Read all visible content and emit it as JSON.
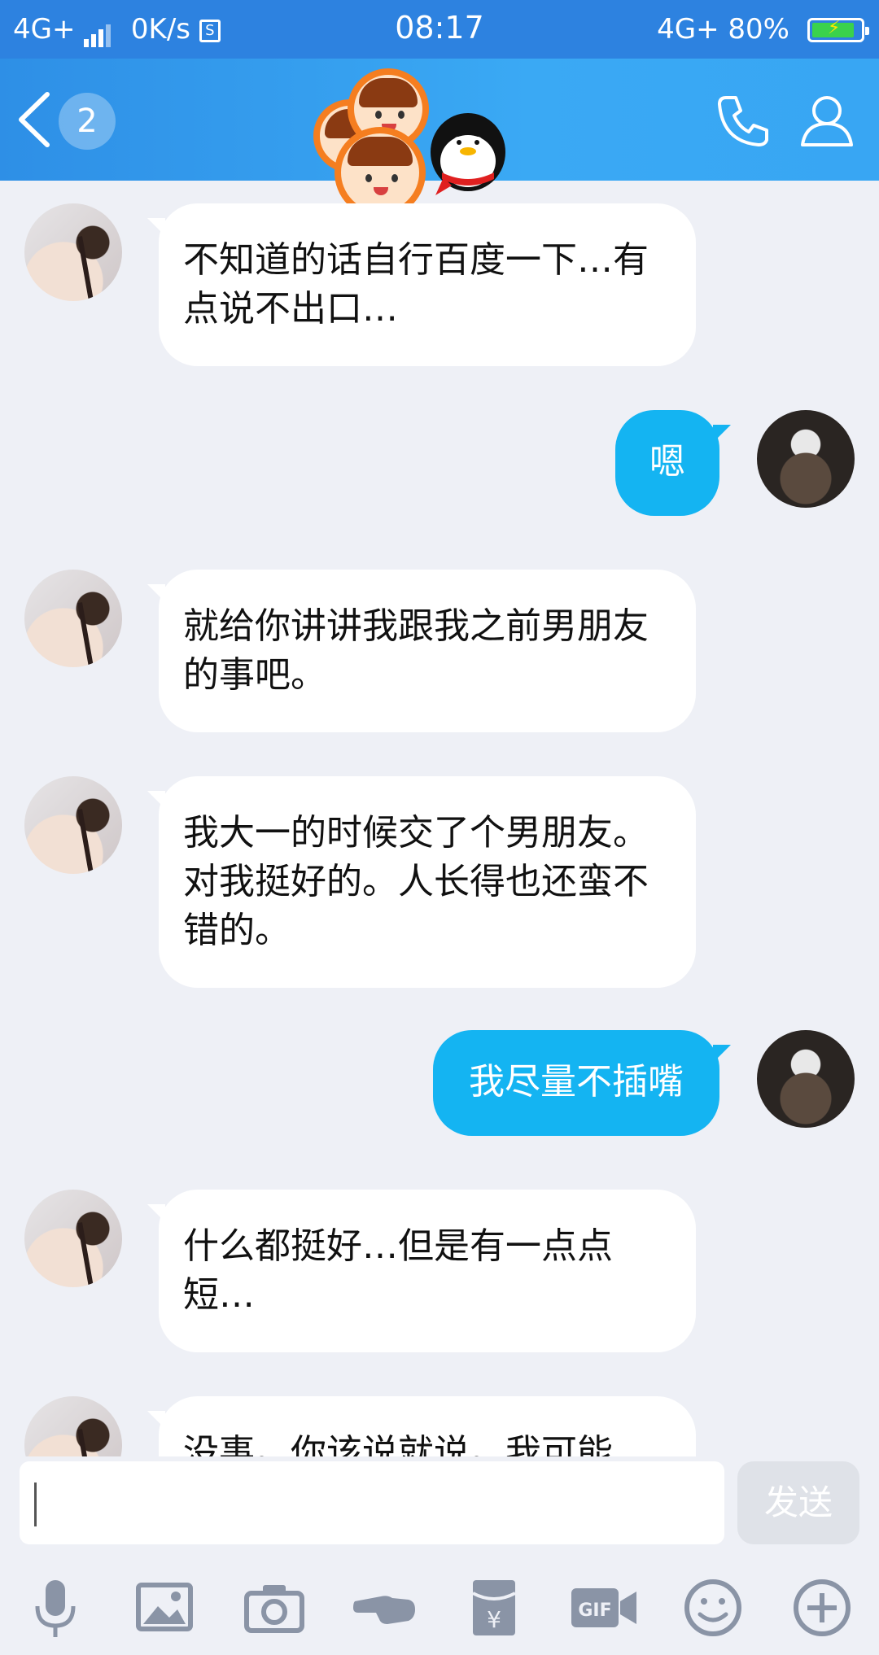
{
  "status_bar": {
    "network_left": "4G+",
    "speed": "0K/s",
    "time": "08:17",
    "network_right": "4G+",
    "battery": "80%"
  },
  "header": {
    "unread_count": "2"
  },
  "messages": [
    {
      "from": "other",
      "text": "不知道的话自行百度一下…有点说不出口…"
    },
    {
      "from": "me",
      "text": "嗯"
    },
    {
      "from": "other",
      "text": "就给你讲讲我跟我之前男朋友的事吧。"
    },
    {
      "from": "other",
      "text": "我大一的时候交了个男朋友。对我挺好的。人长得也还蛮不错的。"
    },
    {
      "from": "me",
      "text": "我尽量不插嘴"
    },
    {
      "from": "other",
      "text": "什么都挺好…但是有一点点短…"
    },
    {
      "from": "other",
      "text": "没事。你该说就说。我可能"
    }
  ],
  "composer": {
    "input_value": "",
    "send_label": "发送"
  },
  "toolbar_icons": [
    "microphone-icon",
    "image-icon",
    "camera-icon",
    "poke-icon",
    "red-packet-icon",
    "gif-icon",
    "emoji-icon",
    "plus-icon"
  ],
  "colors": {
    "header": "#3aa9f4",
    "outgoing_bubble": "#14b4f2",
    "incoming_bubble": "#ffffff",
    "background": "#eef0f6"
  }
}
